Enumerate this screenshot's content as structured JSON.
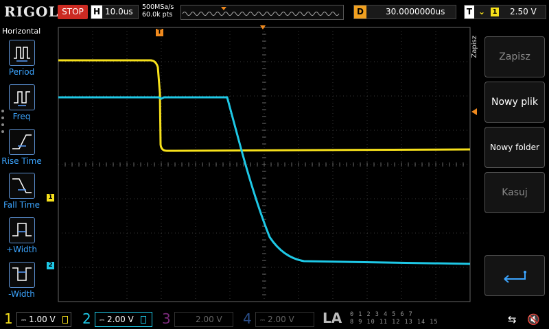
{
  "brand": "RIGOL",
  "run_state": "STOP",
  "horizontal": {
    "key": "H",
    "timebase": "10.0us"
  },
  "sample": {
    "rate": "500MSa/s",
    "points": "60.0k pts"
  },
  "delay": {
    "key": "D",
    "value": "30.0000000us"
  },
  "trigger": {
    "key": "T",
    "edge_symbol": "ꜝ",
    "source": "1",
    "level": "2.50 V"
  },
  "left_menu": {
    "title": "Horizontal",
    "items": [
      {
        "label": "Period"
      },
      {
        "label": "Freq"
      },
      {
        "label": "Rise Time"
      },
      {
        "label": "Fall Time"
      },
      {
        "label": "+Width"
      },
      {
        "label": "-Width"
      }
    ]
  },
  "right_menu": {
    "tab": "Zapisz",
    "items": [
      {
        "label": "Zapisz",
        "enabled": false
      },
      {
        "label": "Nowy plik",
        "enabled": true
      },
      {
        "label": "Nowy folder",
        "enabled": true
      },
      {
        "label": "Kasuj",
        "enabled": false
      },
      {
        "label": "",
        "icon": "return-icon",
        "enabled": true
      }
    ]
  },
  "channels": [
    {
      "num": "1",
      "scale": "1.00 V",
      "color": "#f7e11b",
      "active": true
    },
    {
      "num": "2",
      "scale": "2.00 V",
      "color": "#1ec8e6",
      "active": true
    },
    {
      "num": "3",
      "scale": "2.00 V",
      "color": "#c03cc0",
      "active": false
    },
    {
      "num": "4",
      "scale": "2.00 V",
      "color": "#3c78d8",
      "active": false
    }
  ],
  "la": {
    "label": "LA",
    "row1": "0 1 2 3  4 5 6 7",
    "row2": "8 9 10 11  12 13 14 15"
  },
  "markers": {
    "ch1": "1",
    "ch2": "2",
    "trig": "T"
  },
  "colors": {
    "ch1": "#f7e11b",
    "ch2": "#1ec8e6",
    "accent": "#f08a1e",
    "grid": "#3a3a3a"
  }
}
